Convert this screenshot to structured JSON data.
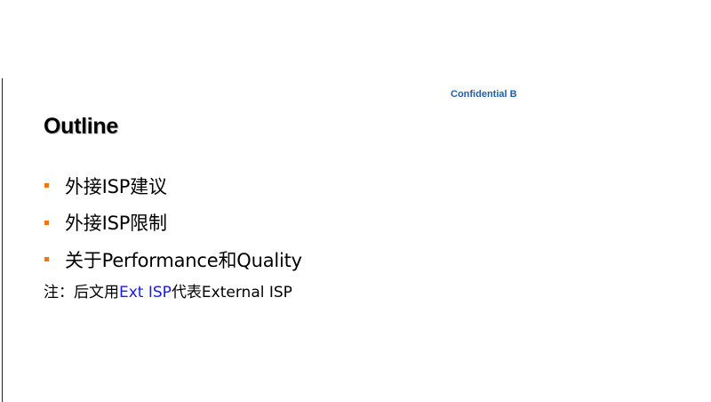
{
  "slide": {
    "classification": "Confidential B",
    "title": "Outline",
    "bullets": [
      "外接ISP建议",
      "外接ISP限制",
      "关于Performance和Quality"
    ],
    "note": {
      "prefix": "注：后文用",
      "highlight": "Ext ISP",
      "suffix": "代表External ISP"
    },
    "colors": {
      "bullet_marker": "#e8781e",
      "classification_text": "#1f5fa8",
      "highlight_text": "#1a1ae6"
    }
  }
}
